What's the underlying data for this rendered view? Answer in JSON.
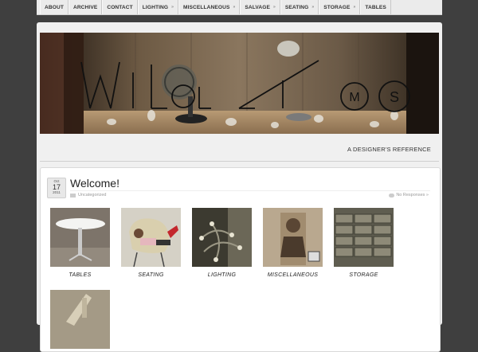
{
  "nav": {
    "items": [
      {
        "label": "ABOUT",
        "dropdown": false
      },
      {
        "label": "ARCHIVE",
        "dropdown": false
      },
      {
        "label": "CONTACT",
        "dropdown": false
      },
      {
        "label": "LIGHTING",
        "dropdown": true
      },
      {
        "label": "MISCELLANEOUS",
        "dropdown": true
      },
      {
        "label": "SALVAGE",
        "dropdown": true
      },
      {
        "label": "SEATING",
        "dropdown": true
      },
      {
        "label": "STORAGE",
        "dropdown": true
      },
      {
        "label": "TABLES",
        "dropdown": false
      }
    ]
  },
  "header": {
    "logo_text": "Wildlims",
    "tagline": "A DESIGNER'S REFERENCE"
  },
  "post": {
    "date": {
      "month": "Oct",
      "day": "17",
      "year": "2011"
    },
    "title": "Welcome!",
    "category": "Uncategorized",
    "responses": "No Responses »",
    "gallery": [
      {
        "caption": "TABLES"
      },
      {
        "caption": "SEATING"
      },
      {
        "caption": "LIGHTING"
      },
      {
        "caption": "MISCELLANEOUS"
      },
      {
        "caption": "STORAGE"
      }
    ]
  },
  "colors": {
    "background": "#3f3f3f",
    "nav_bg": "#ebebeb",
    "content_bg": "#f0f0f0"
  }
}
